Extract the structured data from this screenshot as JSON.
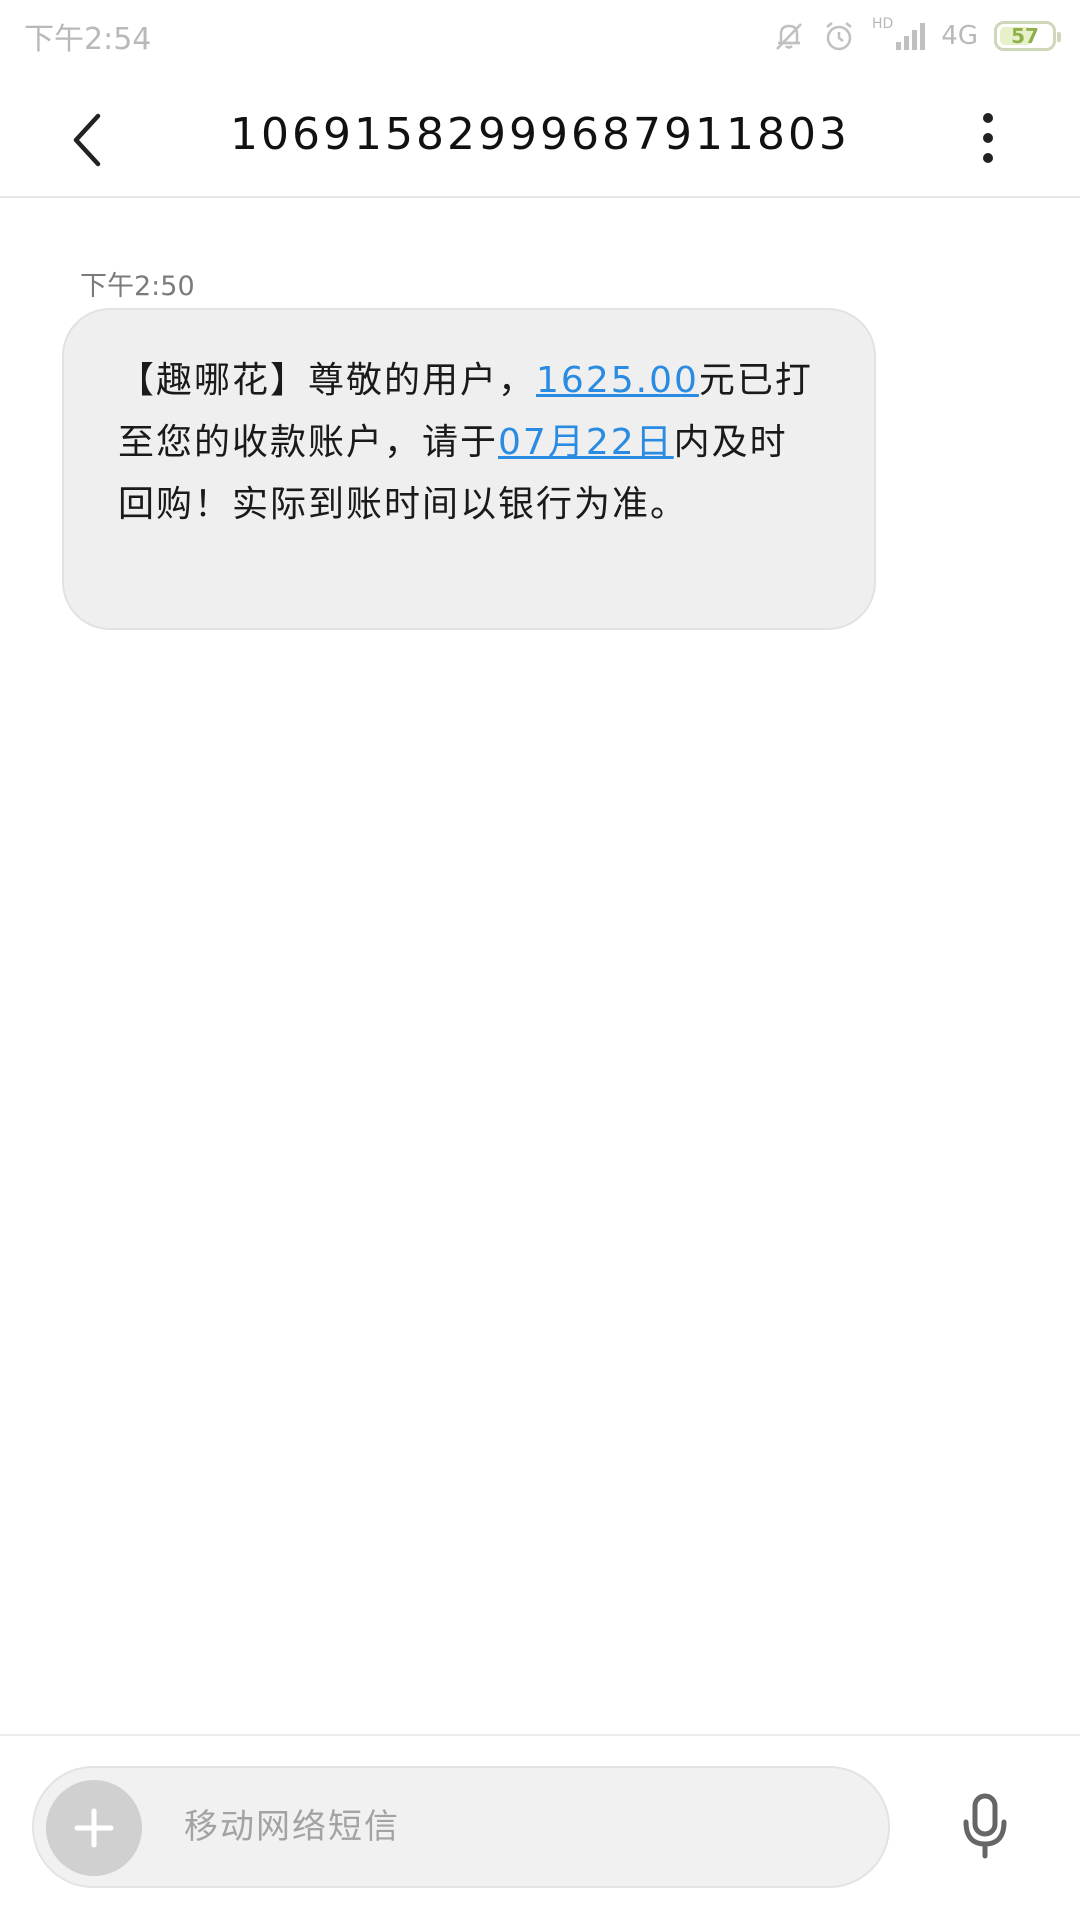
{
  "status_bar": {
    "time": "下午2:54",
    "network": "4G",
    "hd": "HD",
    "battery_level": "57",
    "icons": [
      "mute-icon",
      "alarm-icon",
      "signal-icon",
      "battery-icon"
    ]
  },
  "header": {
    "title": "106915829996879118​03",
    "back_icon": "chevron-left-icon",
    "more_icon": "more-vertical-icon"
  },
  "message": {
    "time": "下午2:50",
    "segments": [
      {
        "text": "【趣哪花】尊敬的用户，",
        "link": false
      },
      {
        "text": "1625.00",
        "link": true
      },
      {
        "text": "元已打至您的收款账户，请于",
        "link": false
      },
      {
        "text": "07月22日",
        "link": true
      },
      {
        "text": "内及时回购！实际到账时间以银行为准。",
        "link": false
      }
    ]
  },
  "composer": {
    "placeholder": "移动网络短信",
    "add_icon": "plus-icon",
    "mic_icon": "microphone-icon"
  },
  "colors": {
    "link": "#2a8be3",
    "bubble_bg": "#efefef",
    "status_text": "#b9b9b9"
  }
}
